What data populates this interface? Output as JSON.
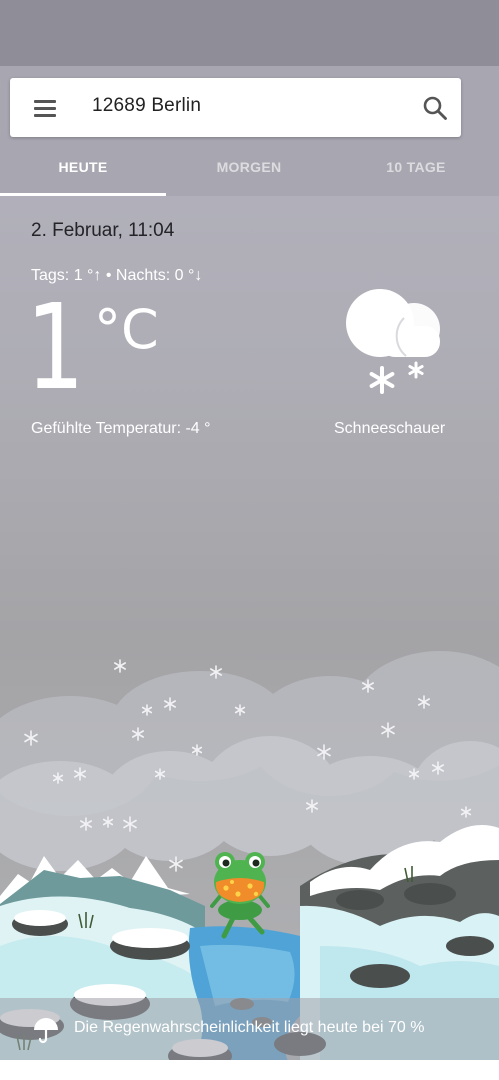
{
  "search": {
    "location": "12689 Berlin"
  },
  "tabs": [
    {
      "label": "HEUTE",
      "active": true
    },
    {
      "label": "MORGEN",
      "active": false
    },
    {
      "label": "10 TAGE",
      "active": false
    }
  ],
  "today": {
    "date": "2. Februar, 11:04",
    "hi_lo": "Tags: 1 °↑ • Nachts: 0 °↓",
    "temperature": "1",
    "unit": "°C",
    "feels_like": "Gefühlte Temperatur: -4 °",
    "condition": "Schneeschauer",
    "condition_icon": "snow-shower-icon"
  },
  "rain": {
    "text": "Die Regenwahrscheinlichkeit liegt heute bei 70 %",
    "icon": "umbrella-icon"
  },
  "colors": {
    "header": "#a8a6b0",
    "status_bar": "#8f8d98",
    "sky": "#a9a9ad"
  }
}
